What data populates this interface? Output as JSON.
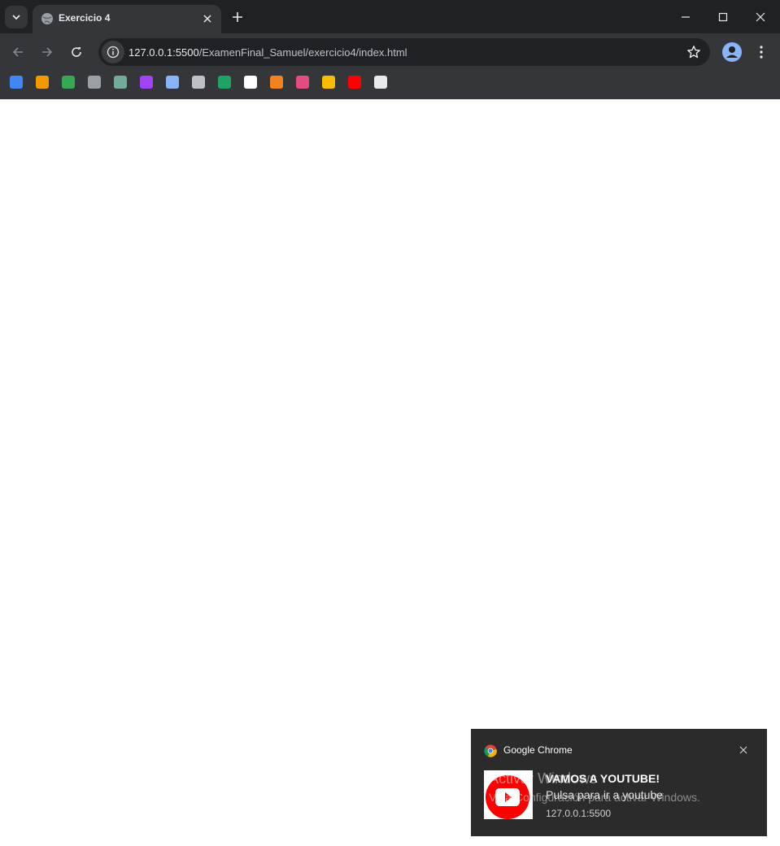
{
  "browser": {
    "tab": {
      "title": "Exercicio 4"
    },
    "address": {
      "host": "127.0.0.1:5500",
      "path": "/ExamenFinal_Samuel/exercicio4/index.html"
    },
    "bookmarks": [
      {
        "icon": "google-icon",
        "color": "#4285f4"
      },
      {
        "icon": "in-icon",
        "color": "#f29900"
      },
      {
        "icon": "drive-icon",
        "color": "#34a853"
      },
      {
        "icon": "github-icon",
        "color": "#9aa0a6"
      },
      {
        "icon": "chatgpt-icon",
        "color": "#74aa9c"
      },
      {
        "icon": "bot-icon",
        "color": "#a142f4"
      },
      {
        "icon": "gemini-icon",
        "color": "#8ab4f8"
      },
      {
        "icon": "globe-icon",
        "color": "#bdc1c6"
      },
      {
        "icon": "grid-icon",
        "color": "#1ea362"
      },
      {
        "icon": "c-icon",
        "color": "#ffffff"
      },
      {
        "icon": "box-icon",
        "color": "#f58220"
      },
      {
        "icon": "color-wheel-icon",
        "color": "#e34c80"
      },
      {
        "icon": "palette-icon",
        "color": "#fbbc04"
      },
      {
        "icon": "youtube-icon",
        "color": "#ff0000"
      },
      {
        "icon": "g-icon",
        "color": "#e8eaed"
      }
    ]
  },
  "notification": {
    "app_name": "Google Chrome",
    "title": "VAMOS A YOUTUBE!",
    "body": "Pulsa para ir a youtube",
    "origin": "127.0.0.1:5500"
  },
  "watermark": {
    "line1": "Activar Windows",
    "line2": "Ve a Configuración para activar Windows."
  }
}
